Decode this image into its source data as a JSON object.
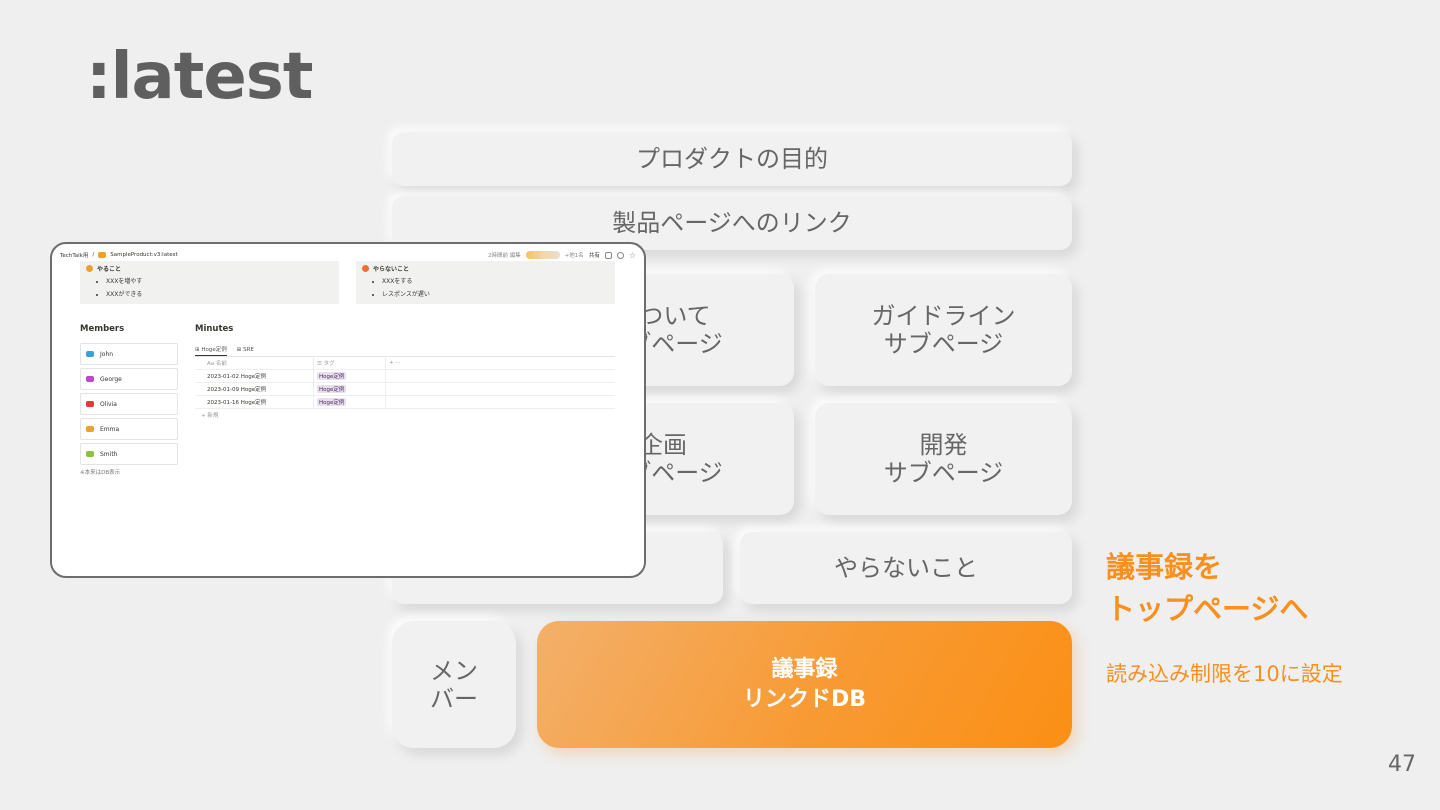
{
  "slide": {
    "title": ":latest",
    "page_number": "47"
  },
  "cards": {
    "purpose": "プロダクトの目的",
    "product_link": "製品ページへのリンク",
    "about_sub": "について\nサブページ",
    "guideline_sub": "ガイドライン\nサブページ",
    "planning_sub": "企画\nサブページ",
    "dev_sub": "開発\nサブページ",
    "not_todo": "やらないこと",
    "members": "メン\nバー",
    "minutes_db": "議事録\nリンクドDB"
  },
  "side": {
    "heading": "議事録を\nトップページへ",
    "note": "読み込み制限を10に設定"
  },
  "colors": {
    "accent": "#f7901e",
    "background": "#efefef",
    "card": "#f1f1f1"
  },
  "screenshot": {
    "breadcrumb_root": "TechTalk用",
    "breadcrumb_page": "SampleProduct:v3:latest",
    "edited": "2時間前 編集",
    "others": "+他1名",
    "share": "共有",
    "todo": {
      "title": "やること",
      "items": [
        "XXXを増やす",
        "XXXができる"
      ]
    },
    "not_todo": {
      "title": "やらないこと",
      "items": [
        "XXXをする",
        "レスポンスが遅い"
      ]
    },
    "members_title": "Members",
    "members": [
      {
        "name": "John",
        "color": "#3aa0e0"
      },
      {
        "name": "George",
        "color": "#c048c8"
      },
      {
        "name": "Olivia",
        "color": "#e03a3a"
      },
      {
        "name": "Emma",
        "color": "#f0a030"
      },
      {
        "name": "Smith",
        "color": "#8cc040"
      }
    ],
    "members_note": "※本来はDB表示",
    "minutes_title": "Minutes",
    "tabs": [
      "Hoge定例",
      "SRE"
    ],
    "columns": [
      "Aa 名前",
      "☰ タグ",
      "+ ···"
    ],
    "rows": [
      {
        "name": "2023-01-02 Hoge定例",
        "tag": "Hoge定例"
      },
      {
        "name": "2023-01-09 Hoge定例",
        "tag": "Hoge定例"
      },
      {
        "name": "2023-01-16 Hoge定例",
        "tag": "Hoge定例"
      }
    ],
    "new_row": "+ 新規"
  }
}
